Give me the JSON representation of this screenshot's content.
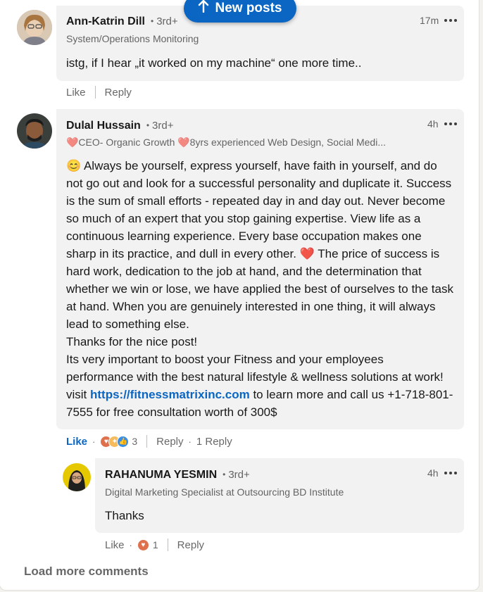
{
  "new_posts": {
    "label": "New posts",
    "icon": "arrow-up-icon"
  },
  "comments": [
    {
      "name": "Ann-Katrin Dill",
      "degree": "3rd+",
      "headline": "System/Operations Monitoring",
      "time": "17m",
      "text": "istg, if I hear „it worked on my machine“ one more time..",
      "actions": {
        "like": "Like",
        "reply": "Reply"
      }
    },
    {
      "name": "Dulal Hussain",
      "degree": "3rd+",
      "headline": "❤️CEO- Organic Growth ❤️8yrs experienced Web Design, Social Medi...",
      "time": "4h",
      "text_before": "😊 Always be yourself, express yourself, have faith in yourself, and do not go out and look for a successful personality and duplicate it. Success is the sum of small efforts - repeated day in and day out. Never become so much of an expert that you stop gaining expertise. View life as a continuous learning experience. Every base occupation makes one sharp in its practice, and dull in every other. ❤️ The price of success is hard work, dedication to the job at hand, and the determination that whether we win or lose, we have applied the best of ourselves to the task at hand. When you are genuinely interested in one thing, it will always lead to something else.",
      "text_thanks": "Thanks for the nice post!",
      "text_promo_before": "Its very important to boost your Fitness and your employees performance with the best natural lifestyle & wellness solutions at work! visit ",
      "link": "https://fitnessmatrixinc.com",
      "text_promo_after": " to learn more and call us +1-718-801-7555 for free consultation worth of 300$",
      "actions": {
        "like": "Like",
        "reaction_count": "3",
        "reply": "Reply",
        "replies": "1 Reply"
      }
    },
    {
      "name": "RAHANUMA YESMIN",
      "degree": "3rd+",
      "headline": "Digital Marketing Specialist at Outsourcing BD Institute",
      "time": "4h",
      "text": "Thanks",
      "actions": {
        "like": "Like",
        "reaction_count": "1",
        "reply": "Reply"
      }
    }
  ],
  "load_more": "Load more comments",
  "colors": {
    "accent": "#0a66c2",
    "bubble": "#f2f2f2"
  }
}
